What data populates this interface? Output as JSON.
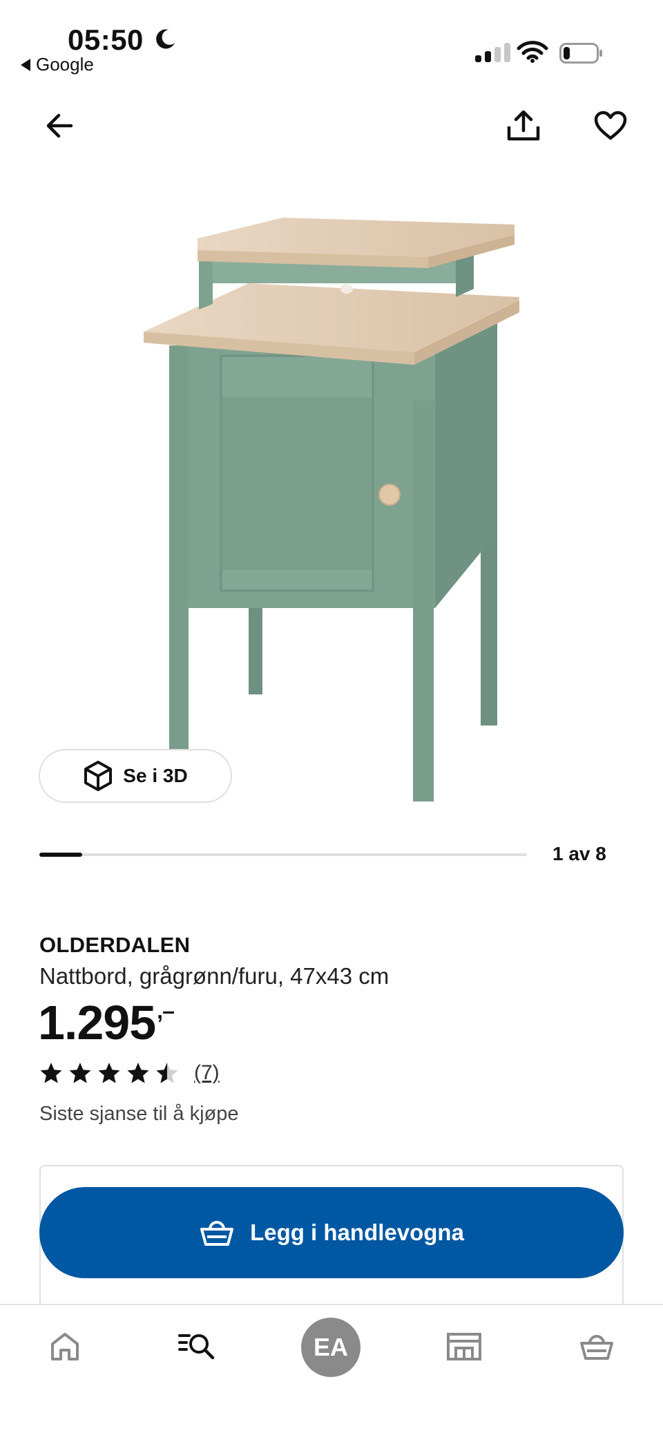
{
  "status_bar": {
    "time": "05:50",
    "back_app": "Google",
    "battery_level": 0.2
  },
  "top_nav": {
    "back_icon": "arrow-left-icon",
    "share_icon": "share-icon",
    "favorite_icon": "heart-icon"
  },
  "product_image": {
    "view_3d_label": "Se i 3D",
    "view_3d_icon": "cube-icon"
  },
  "pager": {
    "label": "1 av 8",
    "current": 1,
    "total": 8
  },
  "product": {
    "name": "OLDERDALEN",
    "description": "Nattbord, grågrønn/furu, 47x43 cm",
    "price": "1.295",
    "price_suffix": ",–",
    "rating": 4.5,
    "rating_max": 5,
    "review_count": "(7)",
    "availability": "Siste sjanse til å kjøpe"
  },
  "cart": {
    "add_label": "Legg i handlevogna",
    "icon": "shopping-basket-icon"
  },
  "bottom_nav": {
    "home_icon": "home-icon",
    "search_icon": "search-icon",
    "avatar_initials": "EA",
    "store_icon": "store-icon",
    "cart_icon": "shopping-basket-icon"
  },
  "colors": {
    "primary_blue": "#0058a3",
    "furniture_green": "#7fa290",
    "pine_wood": "#e7d4bf",
    "avatar_grey": "#8a8a8a"
  }
}
